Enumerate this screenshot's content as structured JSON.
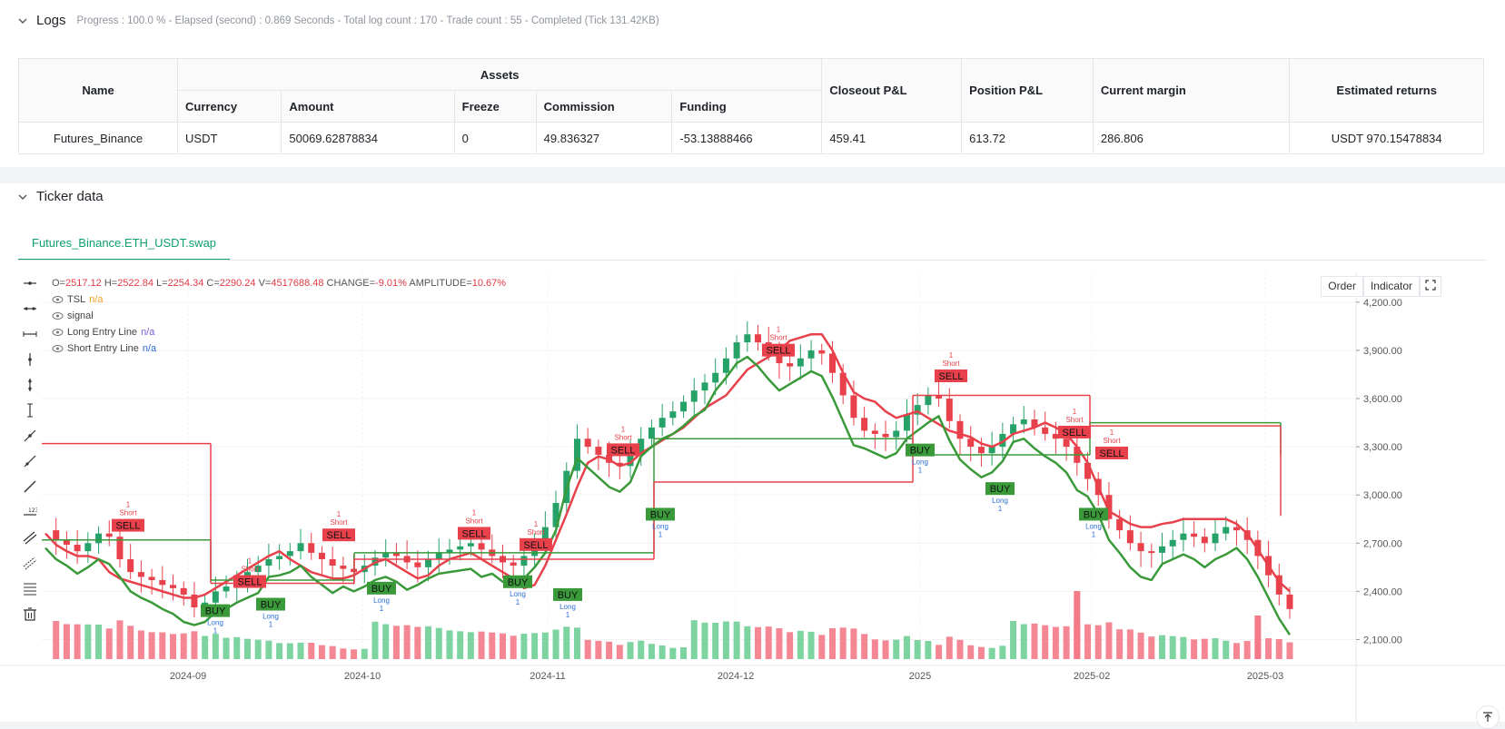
{
  "logs": {
    "title": "Logs",
    "status": "Progress : 100.0 % - Elapsed (second) : 0.869 Seconds - Total log count : 170 - Trade count : 55 - Completed (Tick 131.42KB)"
  },
  "assets_table": {
    "headers": {
      "name": "Name",
      "assets": "Assets",
      "currency": "Currency",
      "amount": "Amount",
      "freeze": "Freeze",
      "commission": "Commission",
      "funding": "Funding",
      "closeout": "Closeout P&L",
      "position": "Position P&L",
      "margin": "Current margin",
      "returns": "Estimated returns"
    },
    "row": {
      "name": "Futures_Binance",
      "currency": "USDT",
      "amount": "50069.62878834",
      "freeze": "0",
      "commission": "49.836327",
      "funding": "-53.13888466",
      "closeout": "459.41",
      "position": "613.72",
      "margin": "286.806",
      "returns": "USDT 970.15478834"
    }
  },
  "ticker": {
    "title": "Ticker data",
    "tab": "Futures_Binance.ETH_USDT.swap"
  },
  "chart_controls": {
    "order": "Order",
    "indicator": "Indicator"
  },
  "legend": {
    "o_label": "O=",
    "o": "2517.12",
    "h_label": "H=",
    "h": "2522.84",
    "l_label": "L=",
    "l": "2254.34",
    "c_label": "C=",
    "c": "2290.24",
    "v_label": "V=",
    "v": "4517688.48",
    "change_label": "CHANGE=",
    "change": "-9.01%",
    "amp_label": "AMPLITUDE=",
    "amp": "10.67%",
    "series": [
      {
        "name": "TSL",
        "value": "n/a"
      },
      {
        "name": "signal",
        "value": ""
      },
      {
        "name": "Long Entry Line",
        "value": "n/a"
      },
      {
        "name": "Short Entry Line",
        "value": "n/a"
      }
    ]
  },
  "colors": {
    "up": "#26a269",
    "down": "#e8414b",
    "long_line": "#3a9a3a",
    "short_line": "#e8414b",
    "accent": "#0e9f6e"
  },
  "chart_data": {
    "type": "candlestick",
    "x_ticks": [
      "2024-09",
      "2024-10",
      "2024-11",
      "2024-12",
      "2025",
      "2025-02",
      "2025-03"
    ],
    "y_ticks": [
      "4,200.00",
      "3,900.00",
      "3,600.00",
      "3,300.00",
      "3,000.00",
      "2,700.00",
      "2,400.00",
      "2,100.00"
    ],
    "ylim": [
      1950,
      4380
    ],
    "close_path": [
      2780,
      2720,
      2690,
      2650,
      2700,
      2760,
      2740,
      2600,
      2520,
      2490,
      2470,
      2440,
      2420,
      2380,
      2300,
      2330,
      2400,
      2430,
      2480,
      2520,
      2560,
      2600,
      2620,
      2650,
      2700,
      2640,
      2600,
      2560,
      2540,
      2520,
      2560,
      2610,
      2640,
      2620,
      2580,
      2550,
      2600,
      2640,
      2660,
      2680,
      2700,
      2660,
      2620,
      2580,
      2560,
      2620,
      2700,
      2800,
      2950,
      3150,
      3350,
      3300,
      3250,
      3200,
      3180,
      3250,
      3350,
      3420,
      3480,
      3520,
      3580,
      3650,
      3700,
      3760,
      3850,
      3950,
      4000,
      3950,
      3880,
      3820,
      3800,
      3850,
      3900,
      3880,
      3760,
      3620,
      3480,
      3400,
      3380,
      3360,
      3400,
      3500,
      3560,
      3620,
      3600,
      3460,
      3350,
      3300,
      3260,
      3300,
      3380,
      3440,
      3470,
      3420,
      3380,
      3350,
      3300,
      3200,
      3100,
      3000,
      2850,
      2780,
      2700,
      2650,
      2640,
      2680,
      2720,
      2760,
      2740,
      2700,
      2760,
      2800,
      2780,
      2720,
      2620,
      2500,
      2380,
      2290
    ],
    "tsl_path": [
      2760,
      2690,
      2650,
      2620,
      2620,
      2600,
      2520,
      2480,
      2460,
      2440,
      2420,
      2400,
      2380,
      2360,
      2360,
      2380,
      2420,
      2460,
      2500,
      2540,
      2580,
      2620,
      2650,
      2600,
      2560,
      2520,
      2500,
      2480,
      2480,
      2500,
      2540,
      2580,
      2600,
      2560,
      2520,
      2480,
      2500,
      2560,
      2600,
      2620,
      2640,
      2600,
      2560,
      2520,
      2480,
      2420,
      2440,
      2560,
      2720,
      2880,
      3050,
      3200,
      3240,
      3220,
      3180,
      3200,
      3260,
      3300,
      3340,
      3380,
      3420,
      3480,
      3540,
      3580,
      3620,
      3700,
      3780,
      3820,
      3860,
      3900,
      3960,
      3980,
      4000,
      4000,
      3900,
      3760,
      3640,
      3600,
      3580,
      3520,
      3480,
      3500,
      3520,
      3480,
      3440,
      3400,
      3380,
      3360,
      3320,
      3300,
      3330,
      3380,
      3400,
      3420,
      3450,
      3420,
      3380,
      3300,
      3200,
      3050,
      2900,
      2860,
      2820,
      2800,
      2800,
      2820,
      2830,
      2850,
      2850,
      2850,
      2850,
      2850,
      2820,
      2760,
      2660,
      2560,
      2460,
      2400
    ],
    "signals": [
      {
        "type": "SELL",
        "label": "Short",
        "qty": "1"
      },
      {
        "type": "BUY",
        "label": "Long",
        "qty": "1"
      },
      {
        "type": "BUY",
        "label": "Long",
        "qty": "1"
      },
      {
        "type": "SELL",
        "label": "Short",
        "qty": "1"
      },
      {
        "type": "SELL",
        "label": "Short",
        "qty": "1"
      },
      {
        "type": "BUY",
        "label": "Long",
        "qty": "1"
      },
      {
        "type": "SELL",
        "label": "Short",
        "qty": "1"
      },
      {
        "type": "SELL",
        "label": "Short",
        "qty": "1"
      },
      {
        "type": "BUY",
        "label": "Long",
        "qty": "1"
      },
      {
        "type": "BUY",
        "label": "Long",
        "qty": "1"
      },
      {
        "type": "SELL",
        "label": "Short",
        "qty": "1"
      },
      {
        "type": "BUY",
        "label": "Long",
        "qty": "1"
      },
      {
        "type": "SELL",
        "label": "Short",
        "qty": "1"
      },
      {
        "type": "SELL",
        "label": "Short",
        "qty": "1"
      },
      {
        "type": "BUY",
        "label": "Long",
        "qty": "1"
      },
      {
        "type": "SELL",
        "label": "Short",
        "qty": "1"
      },
      {
        "type": "BUY",
        "label": "Long",
        "qty": "1"
      },
      {
        "type": "SELL",
        "label": "Short",
        "qty": "1"
      },
      {
        "type": "BUY",
        "label": "Long",
        "qty": "1"
      }
    ],
    "long_entry_levels": [
      2720,
      2470,
      2640,
      3350,
      3250,
      3450,
      3250
    ],
    "short_entry_levels": [
      3320,
      2450,
      2600,
      3080,
      3620,
      3430,
      2870
    ]
  }
}
